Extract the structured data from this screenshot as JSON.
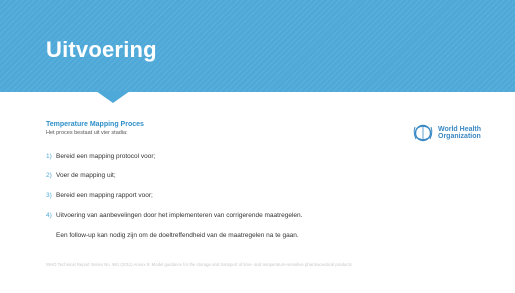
{
  "slide": {
    "title": "Uitvoering",
    "section_title": "Temperature Mapping Proces",
    "subtitle": "Het proces bestaat uit vier stadia:",
    "items": [
      {
        "num": "1)",
        "text": "Bereid een mapping protocol voor;"
      },
      {
        "num": "2)",
        "text": "Voer de mapping uit;"
      },
      {
        "num": "3)",
        "text": "Bereid een mapping rapport voor;"
      },
      {
        "num": "4)",
        "text": "Uitvoering van aanbevelingen door het implementeren van corrigerende maatregelen."
      }
    ],
    "followup": "Een follow-up kan nodig zijn om de doeltreffendheid van de maatregelen na te gaan.",
    "footer": "WHO Technical Report Series No. 961 (2011) Annex 9: Model guidance for the storage and transport of time- and temperature-sensitive pharmaceutical products"
  },
  "logo": {
    "line1": "World Health",
    "line2": "Organization",
    "icon": "who-emblem-icon"
  },
  "colors": {
    "header": "#4fa9d8",
    "accent": "#2e8fc8",
    "logo": "#3b89c4"
  }
}
